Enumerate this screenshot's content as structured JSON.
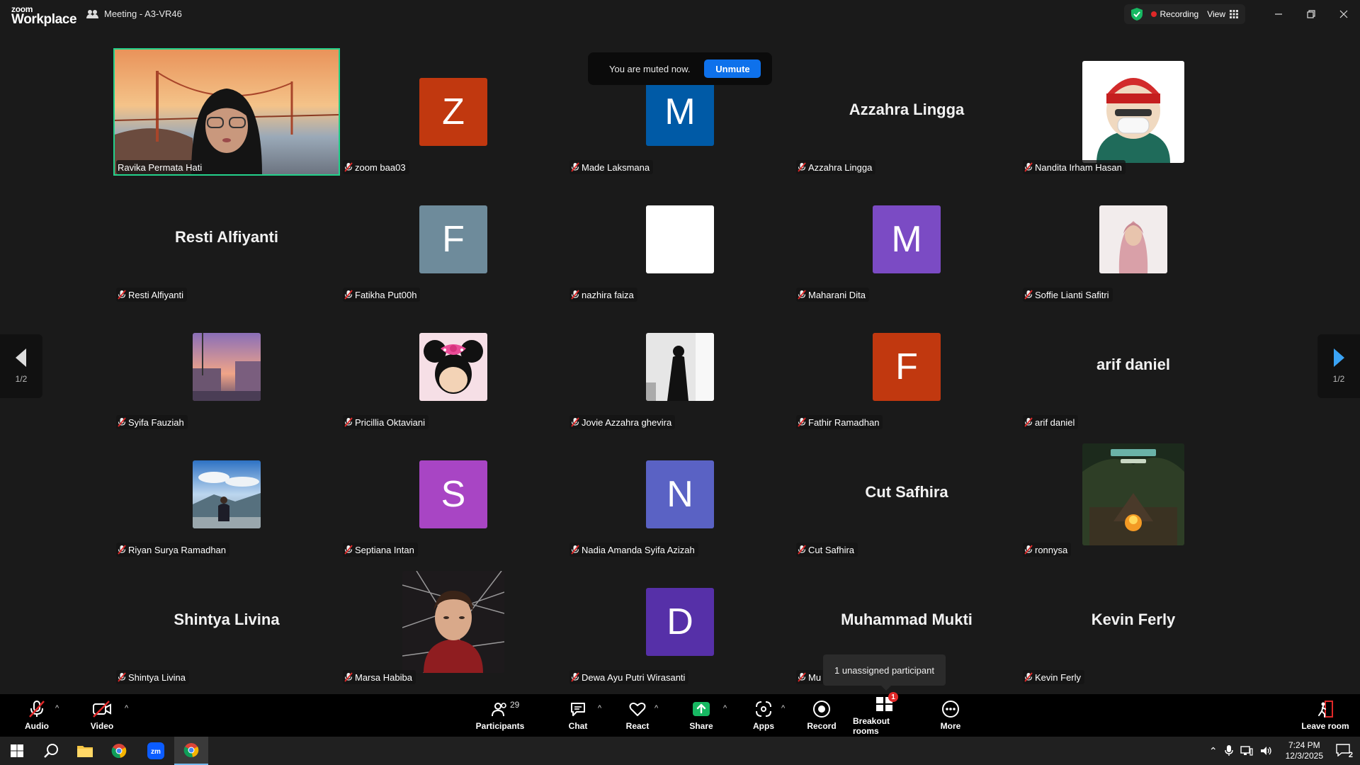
{
  "titlebar": {
    "brand_small": "zoom",
    "brand_big": "Workplace",
    "meeting_title": "Meeting - A3-VR46",
    "recording_label": "Recording",
    "view_label": "View"
  },
  "toast": {
    "message": "You are muted now.",
    "unmute_label": "Unmute"
  },
  "pager": {
    "left_label": "1/2",
    "right_label": "1/2"
  },
  "participants": [
    {
      "name": "Ravika Permata Hati",
      "kind": "video"
    },
    {
      "name": "zoom baa03",
      "kind": "letter",
      "letter": "Z",
      "color": "#c1380f"
    },
    {
      "name": "Made Laksmana",
      "kind": "letter",
      "letter": "M",
      "color": "#005aa6"
    },
    {
      "name": "Azzahra Lingga",
      "kind": "text",
      "display": "Azzahra Lingga"
    },
    {
      "name": "Nandita Irham Hasan",
      "kind": "picture",
      "icon": "avatar-cartoon-helmet"
    },
    {
      "name": "Resti Alfiyanti",
      "kind": "text",
      "display": "Resti Alfiyanti"
    },
    {
      "name": "Fatikha Put00h",
      "kind": "letter",
      "letter": "F",
      "color": "#6e8b9b"
    },
    {
      "name": "nazhira faiza",
      "kind": "picture",
      "icon": "blank-white"
    },
    {
      "name": "Maharani Dita",
      "kind": "letter",
      "letter": "M",
      "color": "#7b4bc4"
    },
    {
      "name": "Soffie Lianti Safitri",
      "kind": "picture",
      "icon": "hijab-portrait"
    },
    {
      "name": "Syifa Fauziah",
      "kind": "picture",
      "icon": "sunset-street"
    },
    {
      "name": "Pricillia Oktaviani",
      "kind": "picture",
      "icon": "minnie-mouse"
    },
    {
      "name": "Jovie Azzahra ghevira",
      "kind": "picture",
      "icon": "silhouette"
    },
    {
      "name": "Fathir Ramadhan",
      "kind": "letter",
      "letter": "F",
      "color": "#c1380f"
    },
    {
      "name": "arif daniel",
      "kind": "text",
      "display": "arif daniel"
    },
    {
      "name": "Riyan Surya Ramadhan",
      "kind": "picture",
      "icon": "mountain-photo"
    },
    {
      "name": "Septiana Intan",
      "kind": "letter",
      "letter": "S",
      "color": "#a845c4"
    },
    {
      "name": "Nadia Amanda Syifa Azizah",
      "kind": "letter",
      "letter": "N",
      "color": "#5a62c4"
    },
    {
      "name": "Cut Safhira",
      "kind": "text",
      "display": "Cut Safhira"
    },
    {
      "name": "ronnysa",
      "kind": "picture",
      "icon": "game-campfire"
    },
    {
      "name": "Shintya Livina",
      "kind": "text",
      "display": "Shintya Livina"
    },
    {
      "name": "Marsa Habiba",
      "kind": "picture",
      "icon": "spiderman-portrait"
    },
    {
      "name": "Dewa Ayu Putri Wirasanti",
      "kind": "letter",
      "letter": "D",
      "color": "#5630a8"
    },
    {
      "name": "Mu",
      "kind": "text",
      "display": "Muhammad Mukti"
    },
    {
      "name": "Kevin Ferly",
      "kind": "text",
      "display": "Kevin Ferly"
    }
  ],
  "tooltip": {
    "text": "1 unassigned participant"
  },
  "toolbar": {
    "audio": "Audio",
    "video": "Video",
    "participants": "Participants",
    "participants_count": "29",
    "chat": "Chat",
    "react": "React",
    "share": "Share",
    "apps": "Apps",
    "record": "Record",
    "breakout": "Breakout rooms",
    "breakout_badge": "1",
    "more": "More",
    "leave": "Leave room"
  },
  "taskbar": {
    "time": "7:24 PM",
    "date": "12/3/2025",
    "notif_count": "2"
  },
  "colors": {
    "accent_green": "#23d18b",
    "unmute_blue": "#0e71eb",
    "recording_red": "#e02828",
    "share_green": "#17b862"
  }
}
